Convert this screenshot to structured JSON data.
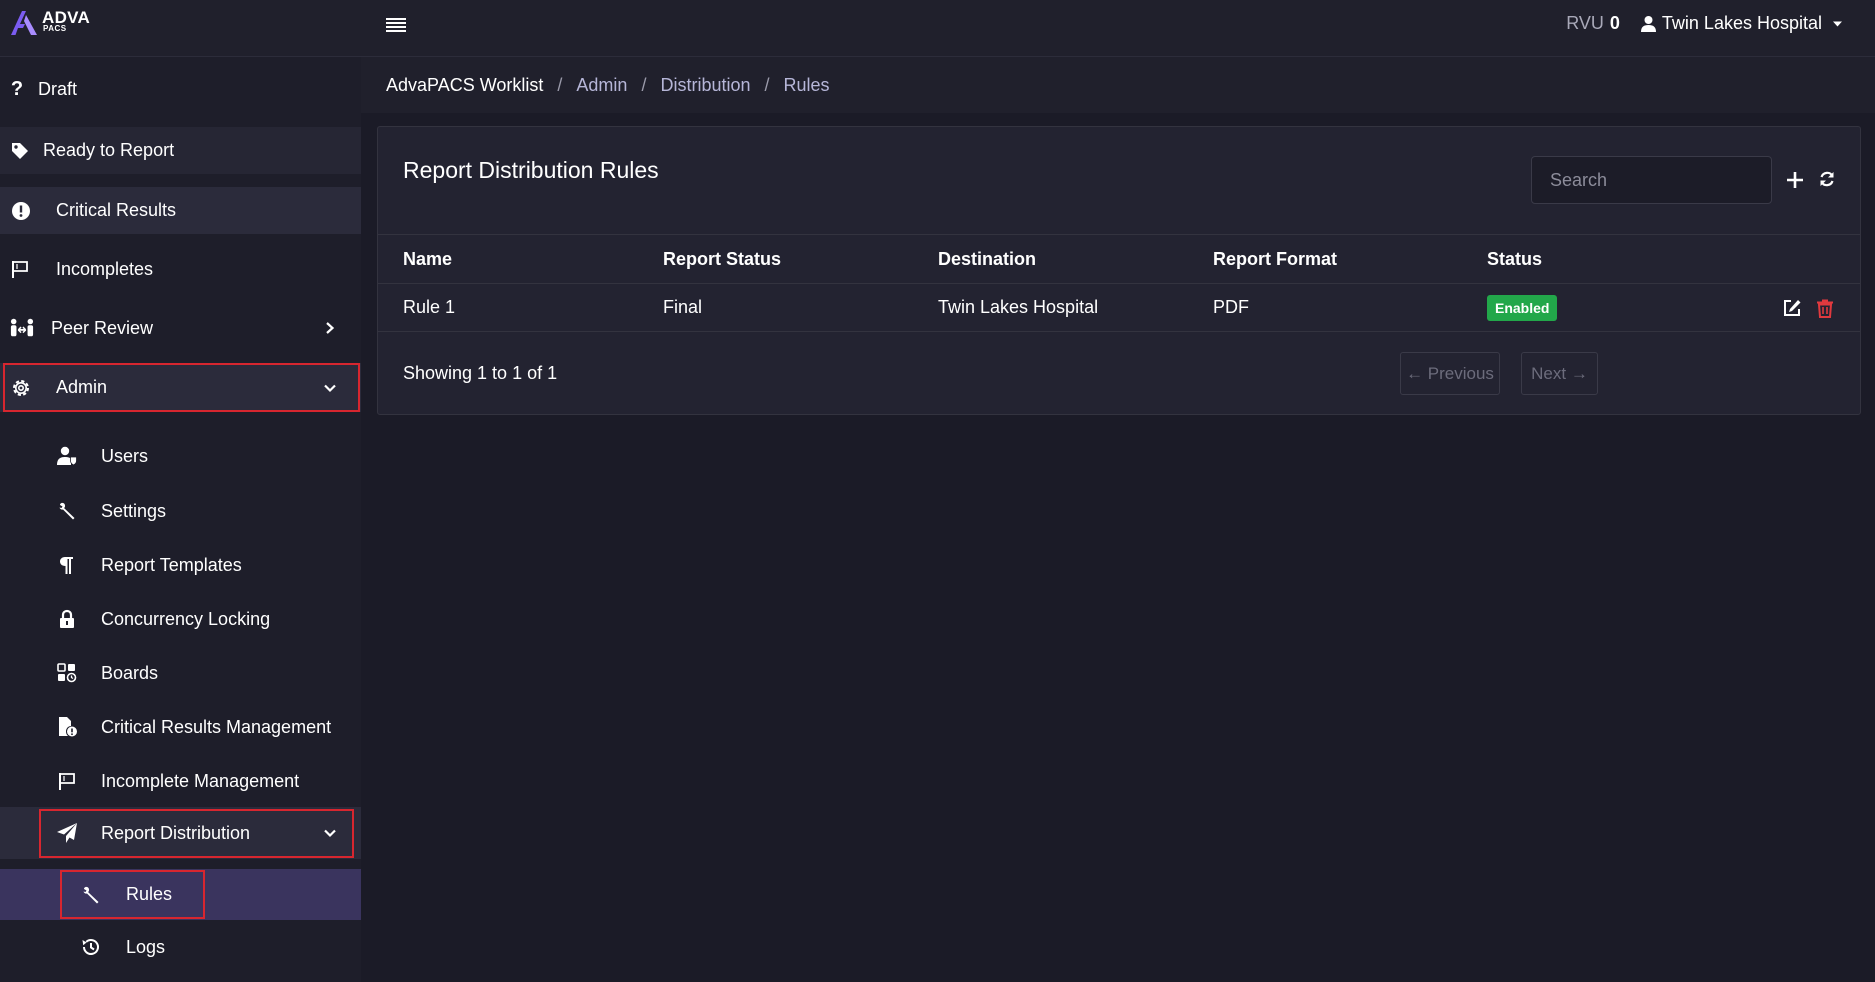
{
  "app": {
    "logo_word": "ADVA",
    "logo_sub": "PACS"
  },
  "topbar": {
    "rvu_label": "RVU",
    "rvu_value": "0",
    "user_name": "Twin Lakes Hospital"
  },
  "sidebar": {
    "items": [
      {
        "label": "Draft",
        "icon": "question-icon"
      },
      {
        "label": "Ready to Report",
        "icon": "tag-icon"
      },
      {
        "label": "Critical Results",
        "icon": "alert-circle-icon"
      },
      {
        "label": "Incompletes",
        "icon": "flag-icon"
      },
      {
        "label": "Peer Review",
        "icon": "people-arrows-icon"
      },
      {
        "label": "Admin",
        "icon": "gear-icon"
      }
    ],
    "admin_items": [
      {
        "label": "Users",
        "icon": "user-shield-icon"
      },
      {
        "label": "Settings",
        "icon": "wrench-icon"
      },
      {
        "label": "Report Templates",
        "icon": "paragraph-icon"
      },
      {
        "label": "Concurrency Locking",
        "icon": "lock-icon"
      },
      {
        "label": "Boards",
        "icon": "boards-icon"
      },
      {
        "label": "Critical Results Management",
        "icon": "file-alert-icon"
      },
      {
        "label": "Incomplete Management",
        "icon": "flag-icon"
      },
      {
        "label": "Report Distribution",
        "icon": "paper-plane-icon"
      }
    ],
    "distribution_items": [
      {
        "label": "Rules",
        "icon": "wrench-icon"
      },
      {
        "label": "Logs",
        "icon": "history-icon"
      }
    ]
  },
  "breadcrumb": {
    "root": "AdvaPACS Worklist",
    "items": [
      "Admin",
      "Distribution",
      "Rules"
    ],
    "separator": "/"
  },
  "main": {
    "title": "Report Distribution Rules",
    "search_placeholder": "Search",
    "columns": [
      "Name",
      "Report Status",
      "Destination",
      "Report Format",
      "Status"
    ],
    "rows": [
      {
        "name": "Rule 1",
        "report_status": "Final",
        "destination": "Twin Lakes Hospital",
        "report_format": "PDF",
        "status": "Enabled"
      }
    ],
    "footer_text": "Showing 1 to 1 of 1",
    "prev_label": "← Previous",
    "next_label": "Next →"
  },
  "colors": {
    "accent": "#7b5cf0",
    "highlight_border": "#d7262f",
    "enabled_badge": "#22a74a",
    "delete_icon": "#e0393e",
    "active_item_bg": "#3a345e"
  }
}
